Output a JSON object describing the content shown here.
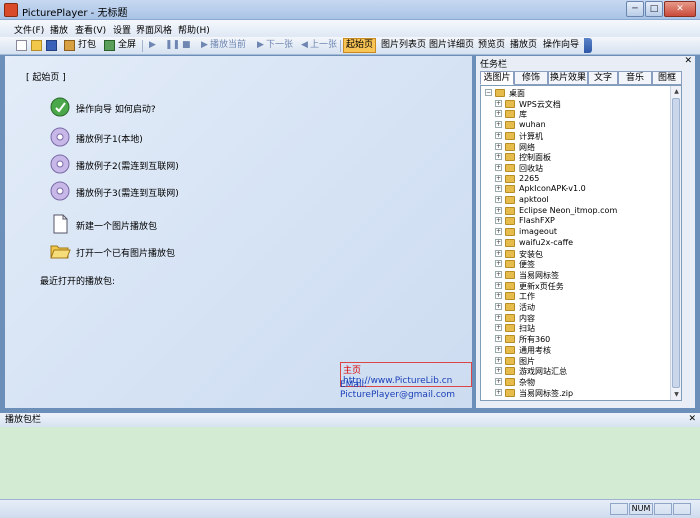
{
  "window": {
    "title": "PicturePlayer - 无标题",
    "min_label": "─",
    "max_label": "□",
    "close_label": "✕"
  },
  "menu": [
    "文件(F)",
    "播放",
    "查看(V)",
    "设置",
    "界面风格",
    "帮助(H)"
  ],
  "toolbar": {
    "pack": "打包",
    "fullscreen": "全屏",
    "play_current": "播放当前",
    "next": "下一张",
    "prev": "上一张",
    "tabs": [
      "起始页",
      "图片列表页",
      "图片详细页",
      "预览页",
      "播放页",
      "操作向导"
    ]
  },
  "main": {
    "breadcrumb": "[ 起始页 ]",
    "actions": [
      {
        "label": "操作向导  如何启动?",
        "icon": "wizard-icon"
      },
      {
        "label": "播放例子1(本地)",
        "icon": "disc-icon"
      },
      {
        "label": "播放例子2(需连到互联网)",
        "icon": "disc-icon"
      },
      {
        "label": "播放例子3(需连到互联网)",
        "icon": "disc-icon"
      },
      {
        "label": "新建一个图片播放包",
        "icon": "new-file-icon"
      },
      {
        "label": "打开一个已有图片播放包",
        "icon": "open-folder-icon"
      }
    ],
    "recent_label": "最近打开的播放包:",
    "homepage_prefix": "主页",
    "homepage_url": "http://www.PictureLib.cn",
    "email": "EMail: PicturePlayer@gmail.com"
  },
  "taskpanel": {
    "title": "任务栏",
    "tabs": [
      "选图片",
      "修饰",
      "换片效果",
      "文字",
      "音乐",
      "图框"
    ],
    "tree": [
      "桌面",
      "WPS云文档",
      "库",
      "wuhan",
      "计算机",
      "网络",
      "控制面板",
      "回收站",
      "2265",
      "ApkIconAPK-v1.0",
      "apktool",
      "Eclipse Neon_itmop.com",
      "FlashFXP",
      "imageout",
      "waifu2x-caffe",
      "安装包",
      "便签",
      "当易网标签",
      "更新x页任务",
      "工作",
      "活动",
      "内容",
      "扫站",
      "所有360",
      "通用考核",
      "图片",
      "游戏网站汇总",
      "杂物",
      "当易网标签.zip"
    ]
  },
  "bottom": {
    "title": "播放包栏",
    "close_label": "✕"
  },
  "status": {
    "num": "NUM"
  }
}
